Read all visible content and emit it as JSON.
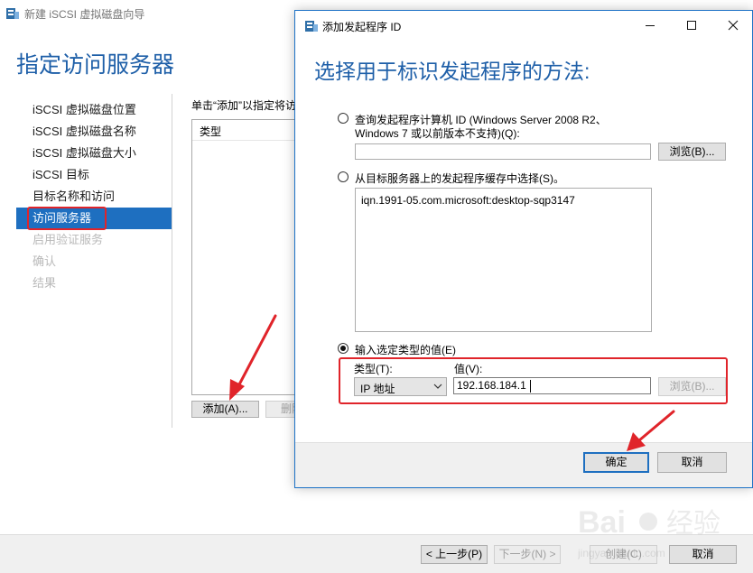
{
  "wizard": {
    "window_title": "新建 iSCSI 虚拟磁盘向导",
    "heading": "指定访问服务器",
    "steps": [
      {
        "label": "iSCSI 虚拟磁盘位置",
        "state": "normal"
      },
      {
        "label": "iSCSI 虚拟磁盘名称",
        "state": "normal"
      },
      {
        "label": "iSCSI 虚拟磁盘大小",
        "state": "normal"
      },
      {
        "label": "iSCSI 目标",
        "state": "normal"
      },
      {
        "label": "目标名称和访问",
        "state": "normal"
      },
      {
        "label": "访问服务器",
        "state": "active"
      },
      {
        "label": "启用验证服务",
        "state": "disabled"
      },
      {
        "label": "确认",
        "state": "disabled"
      },
      {
        "label": "结果",
        "state": "disabled"
      }
    ],
    "instruction": "单击“添加”以指定将访",
    "list_header": "类型",
    "add_button": "添加(A)...",
    "remove_button": "删除",
    "prev_button": "< 上一步(P)",
    "next_button": "下一步(N) >",
    "create_button": "创建(C)",
    "cancel_button": "取消"
  },
  "dialog": {
    "title": "添加发起程序 ID",
    "heading": "选择用于标识发起程序的方法:",
    "option_query": {
      "line1": "查询发起程序计算机 ID (Windows Server 2008 R2、",
      "line2": "Windows 7 或以前版本不支持)(Q):",
      "selected": false,
      "value": "",
      "browse_label": "浏览(B)..."
    },
    "option_cache": {
      "label": "从目标服务器上的发起程序缓存中选择(S)。",
      "selected": false,
      "items": [
        "iqn.1991-05.com.microsoft:desktop-sqp3147"
      ]
    },
    "option_value": {
      "label": "输入选定类型的值(E)",
      "selected": true,
      "type_label": "类型(T):",
      "type_value": "IP 地址",
      "value_label": "值(V):",
      "value": "192.168.184.1",
      "browse_label": "浏览(B)..."
    },
    "ok_button": "确定",
    "cancel_button": "取消"
  },
  "annotation_color": "#e0242a",
  "accent_color": "#1e6fc0"
}
